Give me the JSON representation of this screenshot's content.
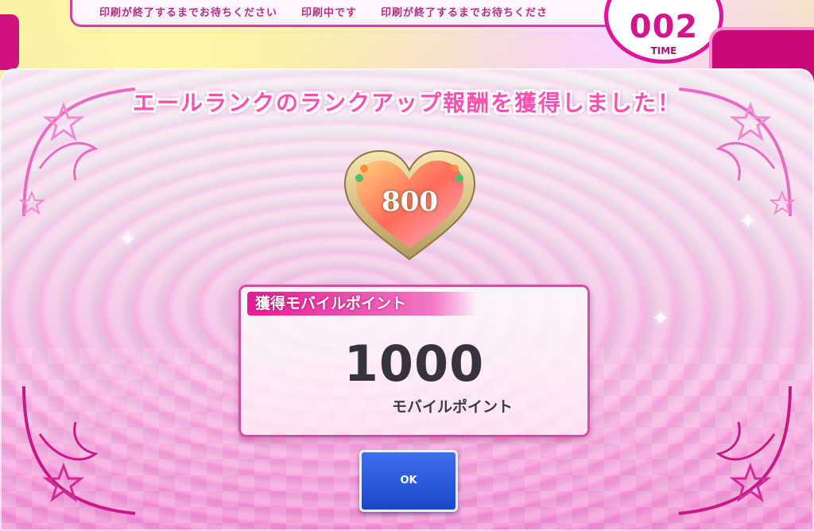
{
  "ticker": {
    "messages": [
      "印刷が終了するまでお待ちください",
      "印刷中です",
      "印刷が終了するまでお待ちくださ"
    ]
  },
  "timer": {
    "value": "002",
    "label": "TIME"
  },
  "dialog": {
    "title": "エールランクのランクアップ報酬を獲得しました！",
    "reward_heart_value": "800",
    "points_label": "獲得モバイルポイント",
    "points_value": "1000",
    "points_unit": "モバイルポイント",
    "ok_label": "OK"
  },
  "colors": {
    "accent_pink": "#e0139c",
    "button_blue": "#2a57dc"
  }
}
